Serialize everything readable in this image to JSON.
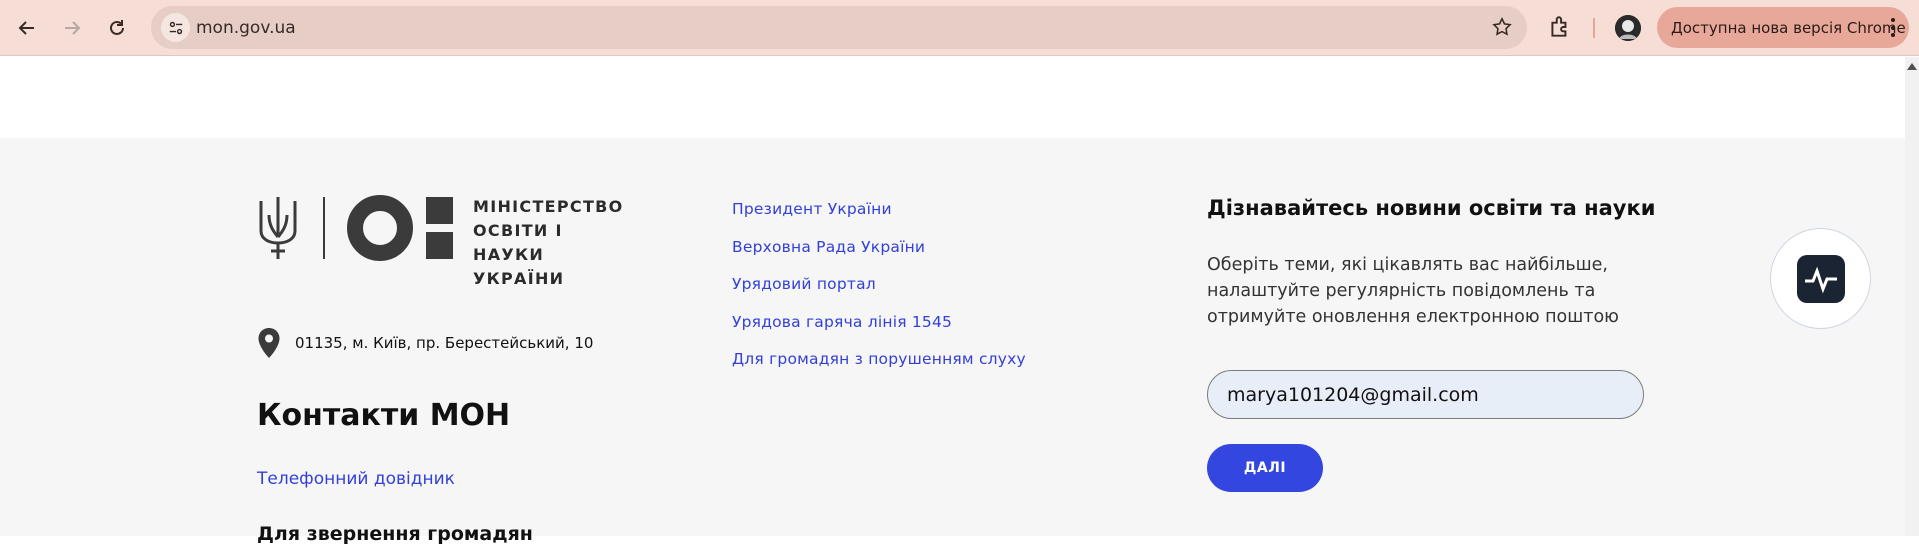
{
  "browser": {
    "url": "mon.gov.ua",
    "update_label": "Доступна нова версія Chrome",
    "icons": [
      "back-icon",
      "forward-icon",
      "reload-icon",
      "site-settings-icon",
      "star-icon",
      "extensions-icon",
      "kebab-icon"
    ]
  },
  "footer": {
    "logo_text": [
      "МІНІСТЕРСТВО",
      "ОСВІТИ І НАУКИ",
      "УКРАЇНИ"
    ],
    "address": "01135, м. Київ, пр. Берестейський, 10",
    "contacts_title": "Контакти МОН",
    "phone_directory": "Телефонний довідник",
    "citizens_heading": "Для звернення громадян",
    "links": [
      "Президент України",
      "Верховна Рада України",
      "Урядовий портал",
      "Урядова гаряча лінія 1545",
      "Для громадян з порушенням слуху"
    ],
    "newsletter": {
      "title": "Дізнавайтесь новини освіти та науки",
      "description": "Оберіть теми, які цікавлять вас найбільше, налаштуйте регулярність повідомлень та отримуйте оновлення електронною поштою",
      "email_value": "marya101204@gmail.com",
      "submit_label": "ДАЛІ"
    }
  },
  "colors": {
    "toolbar_bg": "#f6ddd6",
    "link": "#3340d8",
    "button": "#3446e0",
    "footer_bg": "#f6f6f6"
  }
}
